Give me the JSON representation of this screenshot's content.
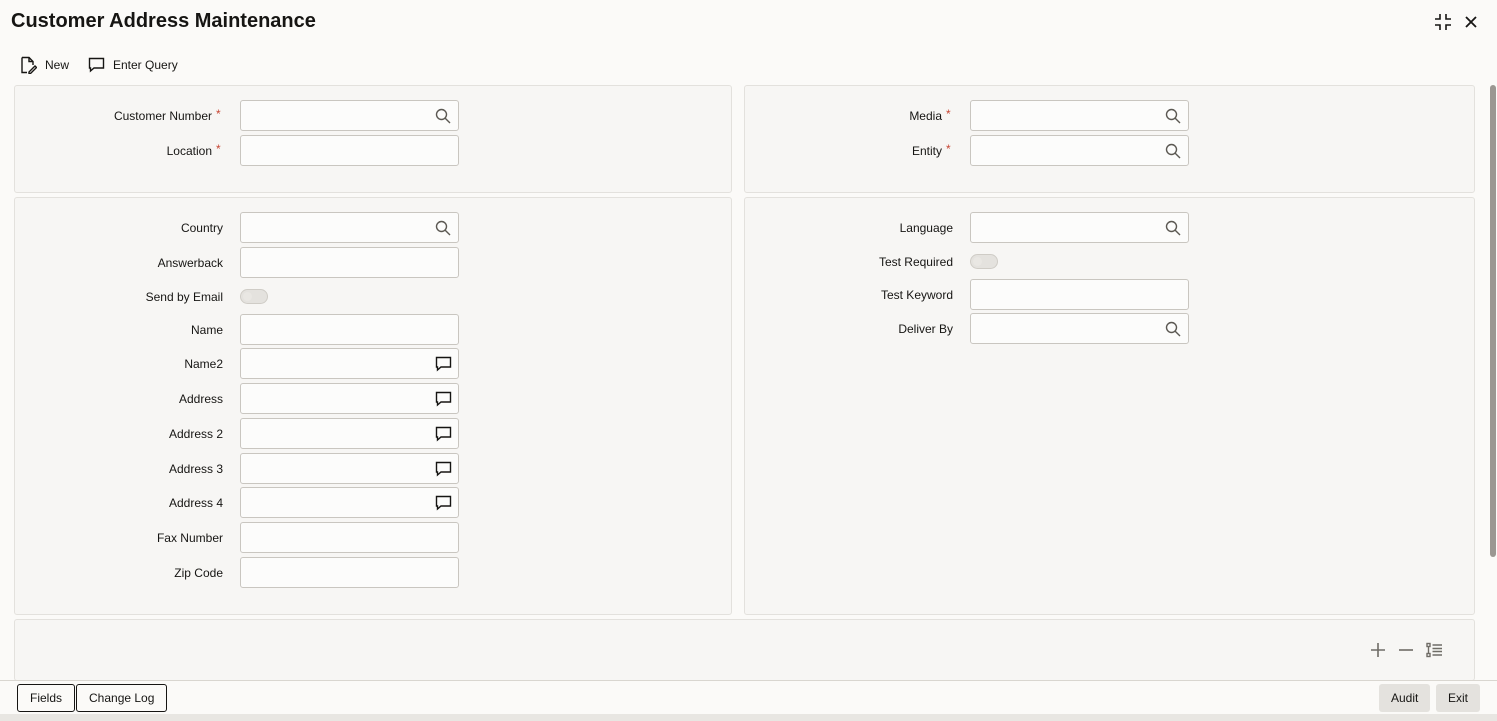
{
  "window": {
    "title": "Customer Address Maintenance"
  },
  "toolbar": {
    "new_label": "New",
    "enter_query_label": "Enter Query"
  },
  "header_panel": {
    "customer_number_label": "Customer Number",
    "location_label": "Location",
    "media_label": "Media",
    "entity_label": "Entity",
    "required_marker": "*"
  },
  "details_panel": {
    "country_label": "Country",
    "answerback_label": "Answerback",
    "send_by_email_label": "Send by Email",
    "name_label": "Name",
    "name2_label": "Name2",
    "address_label": "Address",
    "address2_label": "Address 2",
    "address3_label": "Address 3",
    "address4_label": "Address 4",
    "fax_number_label": "Fax Number",
    "zip_code_label": "Zip Code",
    "language_label": "Language",
    "test_required_label": "Test Required",
    "test_keyword_label": "Test Keyword",
    "deliver_by_label": "Deliver By"
  },
  "footer": {
    "fields_label": "Fields",
    "change_log_label": "Change Log",
    "audit_label": "Audit",
    "exit_label": "Exit"
  },
  "icons": {
    "lookup": "search-icon",
    "multiline": "speech-bubble-icon",
    "add": "plus-icon",
    "remove": "minus-icon",
    "view": "list-icon",
    "new": "new-document-icon",
    "query": "speech-bubble-icon",
    "maximize": "collapse-icon",
    "close": "close-icon"
  },
  "colors": {
    "required": "#c74634",
    "background": "#fbfaf8",
    "panel": "#f7f6f4"
  },
  "toggles": {
    "send_by_email": false,
    "test_required": false
  }
}
